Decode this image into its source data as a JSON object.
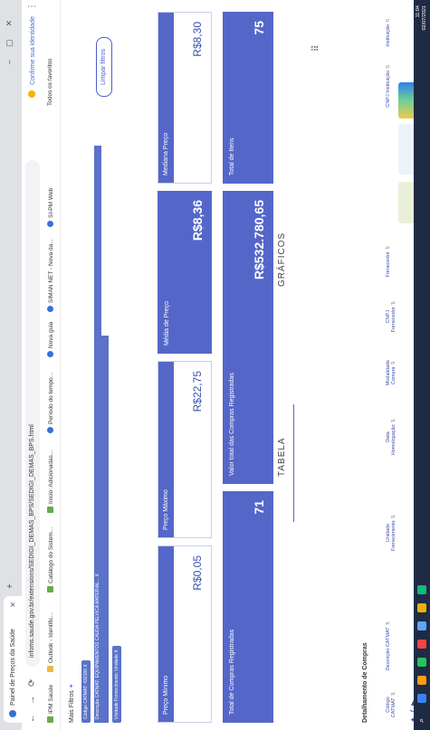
{
  "browser": {
    "tab_title": "Painel de Preços da Saúde",
    "url": "infoms.saude.gov.br/extensions/SEDIGI_DEMAS_BPS/SEDIGI_DEMAS_BPS.html",
    "profile_label": "Confirme sua identidade",
    "reading_list": "Todos os favoritos"
  },
  "bookmarks": [
    "IPM Saúde",
    "Outlook - Identific...",
    "Catálogo do Sistem...",
    "Inicio: Adicionadas...",
    "Período do tempo...",
    "Nova guia",
    "SIMAN NET - Nova da...",
    "SI-PM Web"
  ],
  "filters": {
    "title": "Mais Filtros",
    "tags": [
      "Código CATMAT: 432166  X",
      "Descrição CATMAT: EQUIPAMENTOS CAUDA PELVICA MATERIAL...  X",
      "Unidade Fornecimento: Unidade  X"
    ],
    "clear_button": "Limpar filtros"
  },
  "cards": {
    "preco_minimo": {
      "label": "Preço Mínimo",
      "value": "R$0,05"
    },
    "preco_maximo": {
      "label": "Preço Máximo",
      "value": "R$22,75"
    },
    "media_preco": {
      "label": "Média de Preço",
      "value": "R$8,36"
    },
    "mediana_preco": {
      "label": "Mediana Preço",
      "value": "R$8,30"
    },
    "total_compras": {
      "label": "Total de Compras Registradas",
      "value": "71"
    },
    "valor_total": {
      "label": "Valor total das Compras Registradas",
      "value": "R$532.780,65"
    },
    "total_itens": {
      "label": "Total de Itens",
      "value": "75"
    }
  },
  "view_tabs": {
    "table": "TABELA",
    "charts": "GRÁFICOS"
  },
  "detalhamento": {
    "title": "Detalhamento de Compras",
    "columns": [
      "Código CATMAT",
      "Descrição CATMAT",
      "Unidade Fornecimento",
      "Data Homologação",
      "Modalidade Compra",
      "CNPJ Fornecedor",
      "Fornecedor",
      "CNPJ Instituição",
      "Instituição"
    ]
  },
  "taskbar": {
    "time": "11:04",
    "date": "02/07/2021"
  },
  "colors": {
    "accent": "#5467c9",
    "tag": "#5a72c9",
    "taskbar": "#1f2a44"
  }
}
